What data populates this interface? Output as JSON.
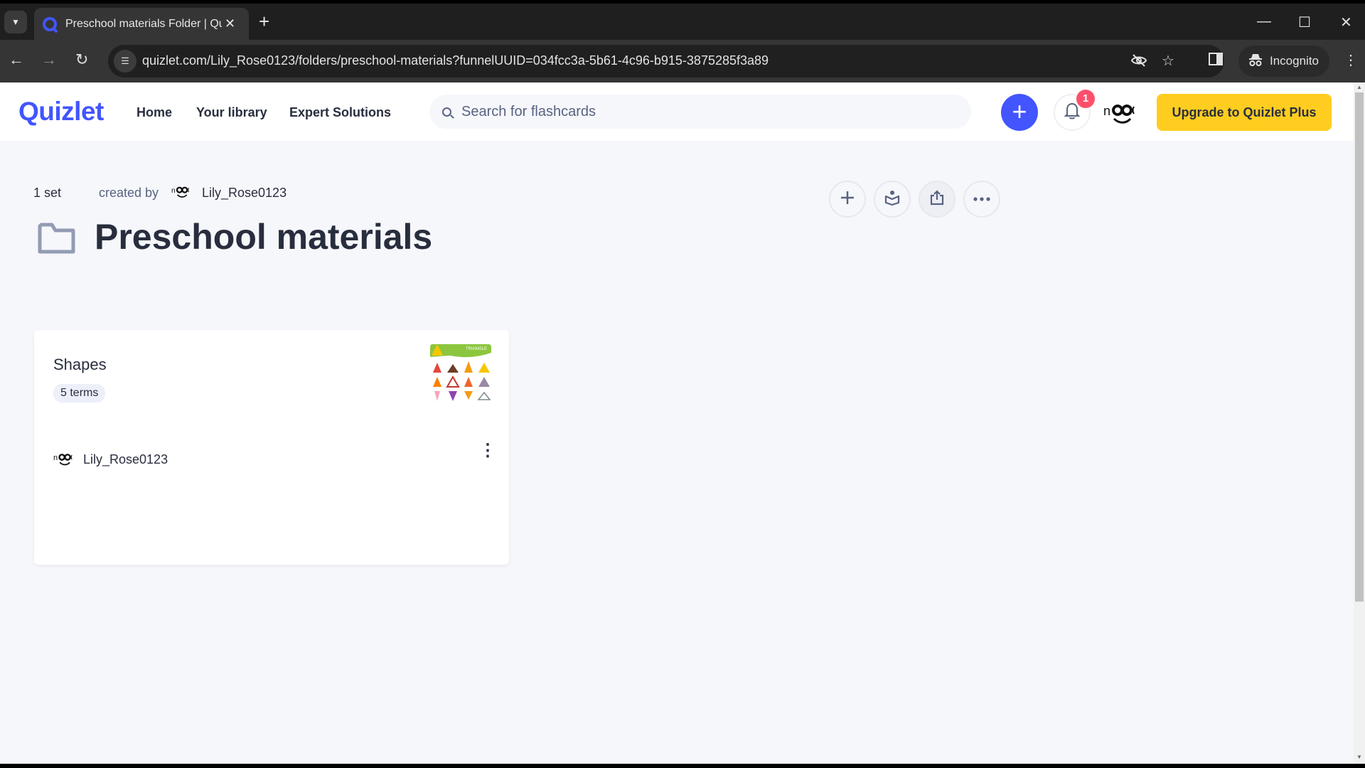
{
  "browser": {
    "tab_title": "Preschool materials Folder | Qu",
    "url": "quizlet.com/Lily_Rose0123/folders/preschool-materials?funnelUUID=034fcc3a-5b61-4c96-b915-3875285f3a89",
    "incognito_label": "Incognito",
    "icons": {
      "tab_search": "chevron-down-icon",
      "favicon": "quizlet-q-icon",
      "close_tab": "close-icon",
      "new_tab": "plus-icon",
      "back": "arrow-left-icon",
      "forward": "arrow-right-icon",
      "reload": "reload-icon",
      "site_info": "tune-icon",
      "tracking": "eye-off-icon",
      "bookmark": "star-icon",
      "side_panel": "side-panel-icon",
      "menu": "kebab-vertical-icon"
    }
  },
  "header": {
    "logo": "Quizlet",
    "nav": [
      "Home",
      "Your library",
      "Expert Solutions"
    ],
    "search_placeholder": "Search for flashcards",
    "notification_count": "1",
    "upgrade_label": "Upgrade to Quizlet Plus",
    "brand_color": "#4255ff",
    "upgrade_color": "#ffcd1f"
  },
  "folder": {
    "set_count": "1 set",
    "created_by_label": "created by",
    "creator": "Lily_Rose0123",
    "title": "Preschool materials",
    "actions": [
      "add-set",
      "study",
      "share",
      "more"
    ]
  },
  "sets": [
    {
      "title": "Shapes",
      "terms": "5 terms",
      "author": "Lily_Rose0123",
      "thumbnail_label": "TRIANGLE"
    }
  ]
}
